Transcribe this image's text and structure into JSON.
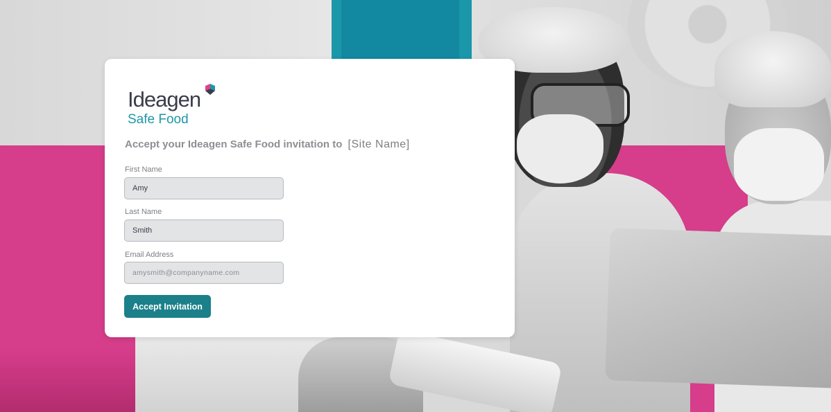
{
  "brand": {
    "name": "Ideagen",
    "product": "Safe Food",
    "colors": {
      "teal": "#1d97a8",
      "button": "#1b8089",
      "pink": "#d63d8a"
    }
  },
  "invitation": {
    "heading": "Accept your Ideagen Safe Food invitation to",
    "site_placeholder": "[Site Name]"
  },
  "form": {
    "first_name": {
      "label": "First Name",
      "value": "Amy"
    },
    "last_name": {
      "label": "Last Name",
      "value": "Smith"
    },
    "email": {
      "label": "Email Address",
      "value": "amysmith@companyname.com"
    },
    "submit_label": "Accept Invitation"
  }
}
